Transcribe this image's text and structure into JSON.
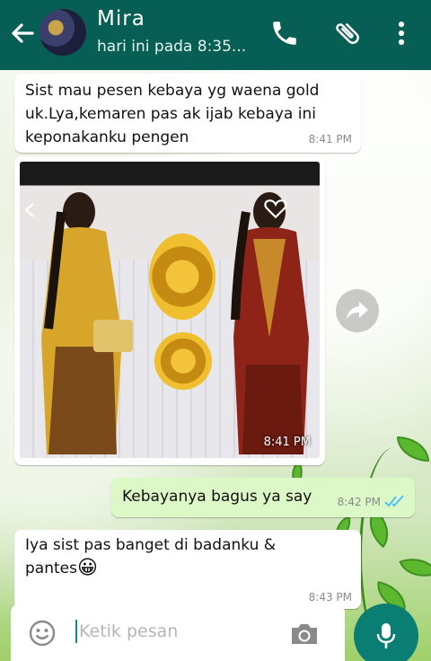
{
  "header": {
    "contact_name": "Mira",
    "status": "hari ini pada 8:35...",
    "icons": [
      "back-arrow-icon",
      "phone-icon",
      "paperclip-icon",
      "more-vert-icon"
    ],
    "bg_color": "#075e54"
  },
  "messages": [
    {
      "direction": "incoming",
      "lines": [
        "Sist mau pesen kebaya yg waena gold",
        "uk.Lya,kemaren pas ak ijab kebaya ini",
        "keponakanku pengen"
      ],
      "time": "8:41 PM"
    },
    {
      "direction": "incoming",
      "type": "image",
      "time": "8:41 PM"
    },
    {
      "direction": "outgoing",
      "lines": [
        "Kebayanya bagus ya say"
      ],
      "time": "8:42 PM",
      "ticks": "read"
    },
    {
      "direction": "incoming",
      "lines": [
        "Iya sist pas banget di badanku &",
        "pantes"
      ],
      "emoji": "😀",
      "time": "8:43 PM"
    }
  ],
  "input": {
    "placeholder": "Ketik pesan",
    "icons": [
      "emoji-icon",
      "camera-icon",
      "mic-icon"
    ]
  },
  "colors": {
    "outgoing_bubble": "#dcf8c6",
    "read_ticks": "#4fc3f7",
    "mic_button": "#0a7e72"
  }
}
